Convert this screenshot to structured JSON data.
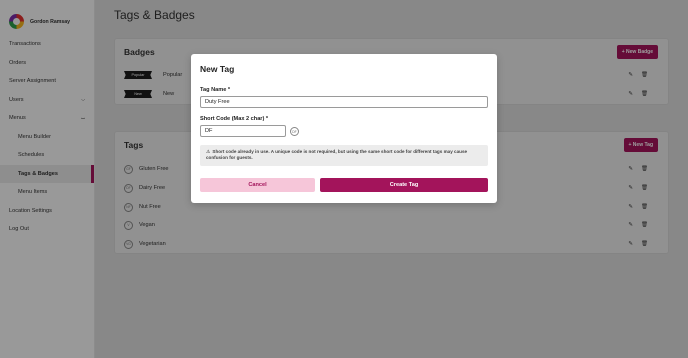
{
  "brand": {
    "name": "Gordon Ramsay"
  },
  "sidebar": {
    "items": [
      {
        "label": "Transactions"
      },
      {
        "label": "Orders"
      },
      {
        "label": "Server Assignment"
      },
      {
        "label": "Users",
        "chevron": "chevron-down-icon"
      },
      {
        "label": "Menus",
        "chevron": "chevron-up-icon"
      },
      {
        "label": "Menu Builder"
      },
      {
        "label": "Schedules"
      },
      {
        "label": "Tags & Badges",
        "active": true
      },
      {
        "label": "Menu Items"
      },
      {
        "label": "Location Settings"
      },
      {
        "label": "Log Out"
      }
    ]
  },
  "page": {
    "title": "Tags & Badges"
  },
  "badges": {
    "title": "Badges",
    "new_button": "+ New Badge",
    "rows": [
      {
        "ribbon": "Popular",
        "name": "Popular"
      },
      {
        "ribbon": "New",
        "name": "New"
      }
    ]
  },
  "tags": {
    "title": "Tags",
    "new_button": "+ New Tag",
    "rows": [
      {
        "code": "GF",
        "name": "Gluten Free"
      },
      {
        "code": "DF",
        "name": "Dairy Free"
      },
      {
        "code": "NF",
        "name": "Nut Free"
      },
      {
        "code": "V",
        "name": "Vegan"
      },
      {
        "code": "VG",
        "name": "Vegetarian"
      }
    ]
  },
  "modal": {
    "title": "New Tag",
    "tag_name_label": "Tag Name *",
    "tag_name_value": "Duty Free",
    "short_code_label": "Short Code (Max 2 char) *",
    "short_code_value": "DF",
    "preview_code": "DF",
    "warning_icon": "⚠",
    "warning_text": "Short code already in use. A unique code is not required, but using the same short code for different tags may cause confusion for guests.",
    "cancel_label": "Cancel",
    "create_label": "Create Tag"
  },
  "icons": {
    "edit": "✎",
    "delete": "🗑"
  },
  "colors": {
    "accent": "#a3145b",
    "accent_light": "#f6c6d9"
  }
}
